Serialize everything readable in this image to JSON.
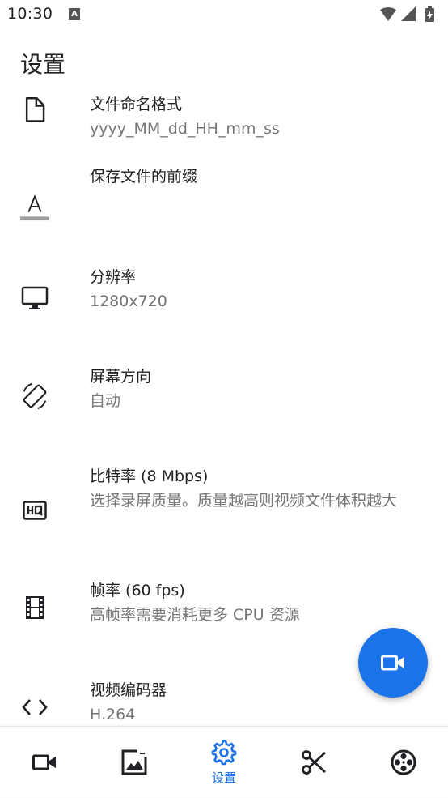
{
  "status_bar": {
    "time": "10:30",
    "notification_icon": "A"
  },
  "header": {
    "title": "设置"
  },
  "preferences": [
    {
      "icon": "file-icon",
      "title": "文件命名格式",
      "summary": "yyyy_MM_dd_HH_mm_ss"
    },
    {
      "icon": "text-format-icon",
      "title": "保存文件的前缀",
      "summary": ""
    },
    {
      "icon": "monitor-icon",
      "title": "分辨率",
      "summary": "1280x720"
    },
    {
      "icon": "screen-rotation-icon",
      "title": "屏幕方向",
      "summary": "自动"
    },
    {
      "icon": "hq-icon",
      "title": "比特率 (8 Mbps)",
      "summary": "选择录屏质量。质量越高则视频文件体积越大"
    },
    {
      "icon": "film-icon",
      "title": "帧率 (60 fps)",
      "summary": "高帧率需要消耗更多 CPU 资源"
    },
    {
      "icon": "code-icon",
      "title": "视频编码器",
      "summary": "H.264"
    }
  ],
  "fab": {
    "icon": "videocam-icon"
  },
  "bottom_nav": {
    "items": [
      {
        "icon": "videocam-icon",
        "label": ""
      },
      {
        "icon": "image-icon",
        "label": ""
      },
      {
        "icon": "settings-icon",
        "label": "设置",
        "active": true
      },
      {
        "icon": "scissors-icon",
        "label": ""
      },
      {
        "icon": "film-reel-icon",
        "label": ""
      }
    ]
  },
  "colors": {
    "accent": "#1a73e8",
    "primary_text": "#202124",
    "secondary_text": "#757575"
  }
}
